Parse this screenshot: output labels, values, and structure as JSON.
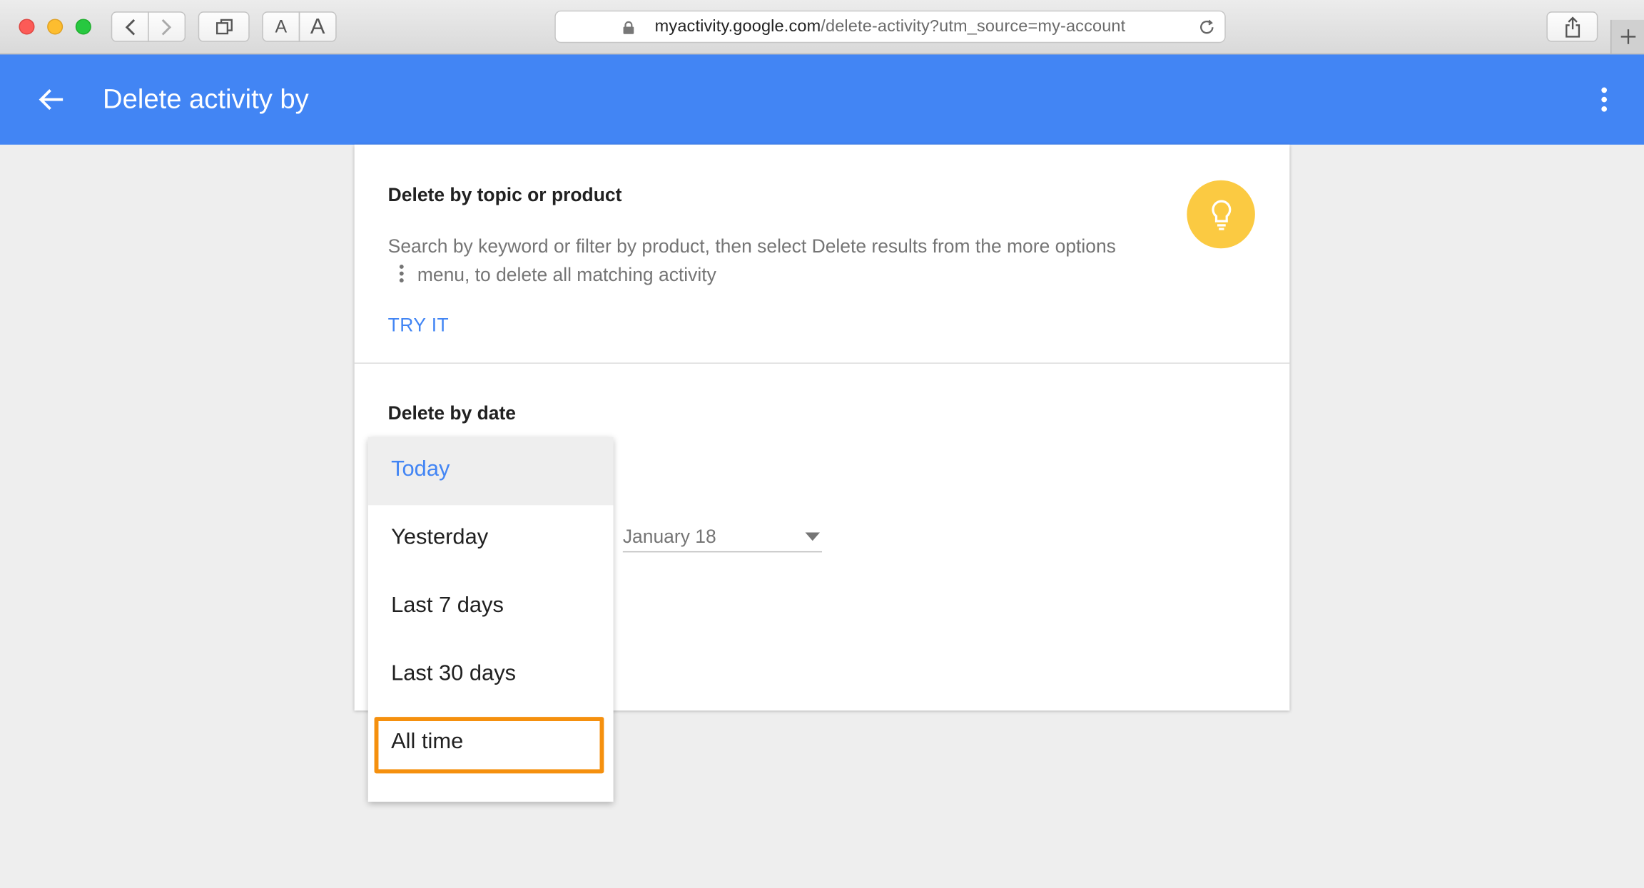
{
  "browser": {
    "url_host": "myactivity.google.com",
    "url_path": "/delete-activity?utm_source=my-account",
    "text_size_small": "A",
    "text_size_large": "A"
  },
  "appbar": {
    "title": "Delete activity by"
  },
  "topic_section": {
    "title": "Delete by topic or product",
    "description_part1": "Search by keyword or filter by product, then select Delete results from the more options",
    "description_part2": "menu, to delete all matching activity",
    "action_label": "TRY IT"
  },
  "date_section": {
    "title": "Delete by date",
    "date_value": "January 18"
  },
  "dropdown": {
    "options": [
      {
        "label": "Today"
      },
      {
        "label": "Yesterday"
      },
      {
        "label": "Last 7 days"
      },
      {
        "label": "Last 30 days"
      },
      {
        "label": "All time"
      }
    ],
    "selected": "Today",
    "highlighted": "All time"
  },
  "colors": {
    "appbar": "#4285f4",
    "accent": "#4285f4",
    "bulb": "#fbca42",
    "highlight": "#f5900e"
  },
  "icons": [
    "back-arrow-icon",
    "more-vert-icon",
    "lightbulb-icon",
    "lock-icon",
    "reload-icon",
    "share-icon",
    "tabs-icon",
    "dropdown-arrow-icon"
  ]
}
